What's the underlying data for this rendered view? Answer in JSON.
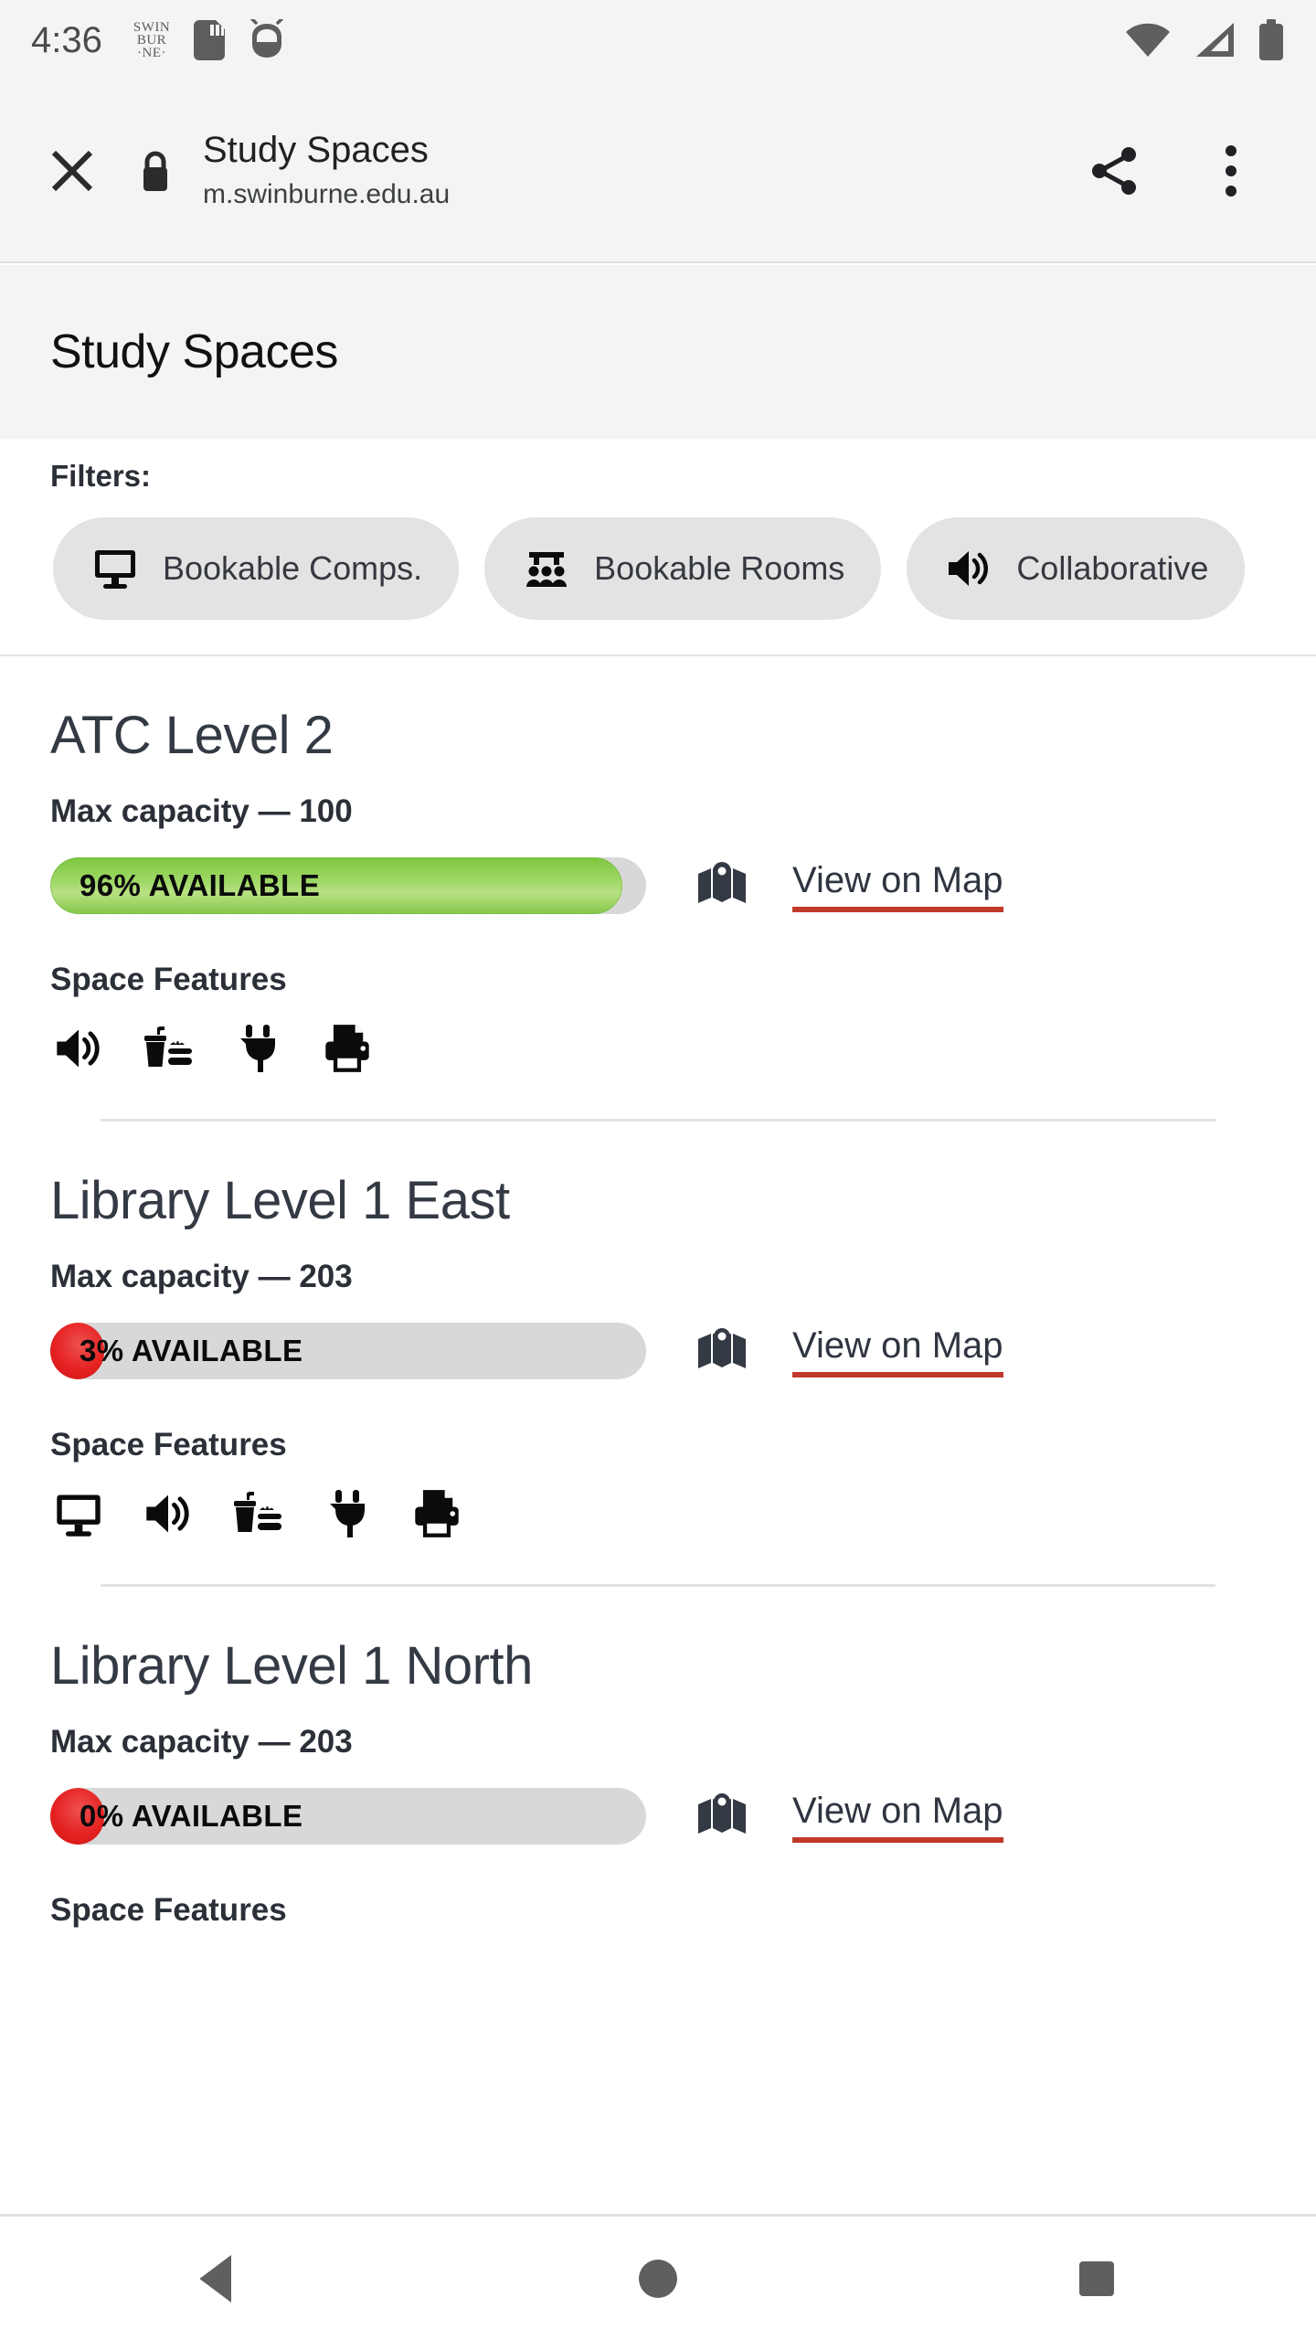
{
  "status_bar": {
    "time": "4:36",
    "carrier_logo_lines": [
      "SWIN",
      "BUR",
      "·NE·"
    ],
    "icons": [
      "sd-card-icon",
      "android-robot-icon",
      "wifi-icon",
      "cell-signal-icon",
      "battery-icon"
    ]
  },
  "browser": {
    "close_label": "×",
    "title": "Study Spaces",
    "url": "m.swinburne.edu.au",
    "lock_icon": "lock-icon",
    "share_icon": "share-icon",
    "more_icon": "more-vertical-icon"
  },
  "page": {
    "heading": "Study Spaces"
  },
  "filters": {
    "label": "Filters:",
    "chips": [
      {
        "label": "Bookable Comps.",
        "icon": "monitor-icon"
      },
      {
        "label": "Bookable Rooms",
        "icon": "meeting-room-icon"
      },
      {
        "label": "Collaborative",
        "icon": "speaker-icon"
      }
    ]
  },
  "spaces": [
    {
      "name": "ATC Level 2",
      "capacity_label": "Max capacity — 100",
      "max_capacity": 100,
      "availability_percent": 96,
      "availability_label": "96% AVAILABLE",
      "bar_color": "#8ecb4e",
      "map_link_label": "View on Map",
      "features_label": "Space Features",
      "features": [
        "speaker-icon",
        "food-drink-icon",
        "power-plug-icon",
        "printer-icon"
      ]
    },
    {
      "name": "Library Level 1 East",
      "capacity_label": "Max capacity — 203",
      "max_capacity": 203,
      "availability_percent": 3,
      "availability_label": "3% AVAILABLE",
      "bar_color": "#e52222",
      "map_link_label": "View on Map",
      "features_label": "Space Features",
      "features": [
        "monitor-icon",
        "speaker-icon",
        "food-drink-icon",
        "power-plug-icon",
        "printer-icon"
      ]
    },
    {
      "name": "Library Level 1 North",
      "capacity_label": "Max capacity — 203",
      "max_capacity": 203,
      "availability_percent": 0,
      "availability_label": "0% AVAILABLE",
      "bar_color": "#e52222",
      "map_link_label": "View on Map",
      "features_label": "Space Features",
      "features": []
    }
  ],
  "nav_bar": {
    "back_label": "back-triangle-icon",
    "home_label": "home-circle-icon",
    "recents_label": "recents-square-icon"
  }
}
